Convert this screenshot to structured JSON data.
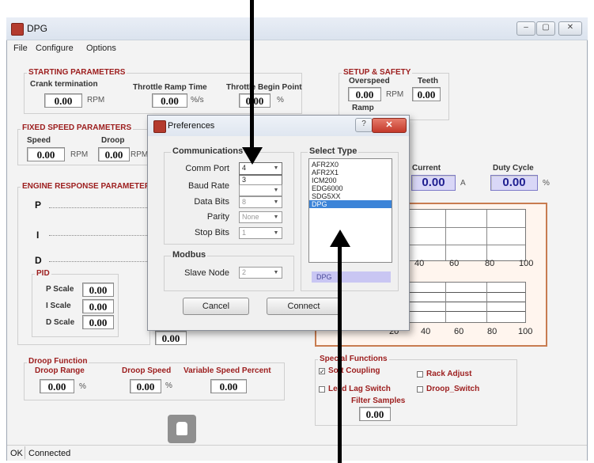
{
  "window": {
    "title": "DPG",
    "controls": [
      "–",
      "▢",
      "✕"
    ]
  },
  "menu": [
    "File",
    "Configure",
    "Options"
  ],
  "starting": {
    "title": "STARTING PARAMETERS",
    "crank_label": "Crank termination",
    "crank_value": "0.00",
    "crank_unit": "RPM",
    "ramp_label": "Throttle Ramp Time",
    "ramp_value": "0.00",
    "ramp_unit": "%/s",
    "begin_label": "Throttle Begin Point",
    "begin_value": "0.00",
    "begin_unit": "%"
  },
  "setup": {
    "title": "SETUP & SAFETY",
    "overspeed_label": "Overspeed",
    "overspeed_value": "0.00",
    "overspeed_unit": "RPM",
    "teeth_label": "Teeth",
    "teeth_value": "0.00",
    "ramp_label": "Ramp"
  },
  "fixed": {
    "title": "FIXED SPEED PARAMETERS",
    "speed_label": "Speed",
    "speed_value": "0.00",
    "speed_unit": "RPM",
    "droop_label": "Droop",
    "droop_value": "0.00",
    "droop_unit": "RPM"
  },
  "readouts": {
    "current_label": "Current",
    "current_value": "0.00",
    "current_unit": "A",
    "duty_label": "Duty Cycle",
    "duty_value": "0.00",
    "duty_unit": "%"
  },
  "engine": {
    "title": "ENGINE RESPONSE PARAMETERS",
    "p_label": "P",
    "i_label": "I",
    "d_label": "D",
    "pid_title": "PID",
    "pscale_label": "P Scale",
    "pscale_value": "0.00",
    "iscale_label": "I Scale",
    "iscale_value": "0.00",
    "dscale_label": "D Scale",
    "dscale_value": "0.00",
    "extra_value": "0.00"
  },
  "chart_ticks": {
    "upper": [
      "40",
      "60",
      "80",
      "100"
    ],
    "lower": [
      "20",
      "40",
      "60",
      "80",
      "100"
    ]
  },
  "droop": {
    "title": "Droop Function",
    "range_label": "Droop Range",
    "range_value": "0.00",
    "range_unit": "%",
    "speed_label": "Droop Speed",
    "speed_value": "0.00",
    "speed_unit": "%",
    "variable_label": "Variable Speed Percent",
    "variable_value": "0.00"
  },
  "special": {
    "title": "Special Functions",
    "soft_coupling": "Soft Coupling",
    "rack_adjust": "Rack Adjust",
    "lead_lag": "Lead Lag Switch",
    "droop_switch": "Droop_Switch",
    "filter_label": "Filter Samples",
    "filter_value": "0.00"
  },
  "status": {
    "ok": "OK",
    "text": "Connected"
  },
  "dialog": {
    "title": "Preferences",
    "comm_title": "Communications",
    "comm_port_label": "Comm Port",
    "comm_port_value": "4",
    "comm_port_dropdown_option": "3",
    "baud_label": "Baud Rate",
    "databits_label": "Data Bits",
    "databits_value": "8",
    "parity_label": "Parity",
    "parity_value": "None",
    "stopbits_label": "Stop Bits",
    "stopbits_value": "1",
    "modbus_title": "Modbus",
    "slave_label": "Slave Node",
    "slave_value": "2",
    "select_title": "Select Type",
    "types": [
      "AFR2X0",
      "AFR2X1",
      "ICM200",
      "EDG6000",
      "SDG5XX",
      "DPG"
    ],
    "selected_type": "DPG",
    "cancel": "Cancel",
    "connect": "Connect"
  }
}
